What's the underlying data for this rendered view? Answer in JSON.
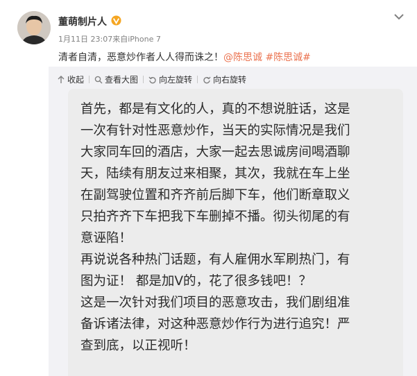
{
  "post": {
    "username": "董萌制片人",
    "time": "1月11日 23:07",
    "source": "来自iPhone 7",
    "text_prefix": "清者自清，恶意炒作者人人得而诛之！",
    "mention": "@陈思诚",
    "hashtag": "#陈思诚#"
  },
  "toolbar": {
    "collapse": "收起",
    "view_large": "查看大图",
    "rotate_left": "向左旋转",
    "rotate_right": "向右旋转"
  },
  "image_text": {
    "lines": [
      "首先，都是有文化的人，真的不想说脏话，这是",
      "一次有针对性恶意炒作，当天的实际情况是我们",
      "大家同车回的酒店，大家一起去思诚房间喝酒聊",
      "天，陆续有朋友过来相聚，其次，我就在车上坐",
      "在副驾驶位置和齐齐前后脚下车，他们断章取义",
      "只拍齐齐下车把我下车删掉不播。彻头彻尾的有",
      "意诬陷！",
      "再说说各种热门话题，有人雇佣水军刷热门，有",
      "图为证！ 都是加V的，花了很多钱吧！？",
      "这是一次针对我们项目的恶意攻击，我们剧组准",
      "备诉诸法律，对这种恶意炒作行为进行追究！严",
      "查到底，以正视听！"
    ]
  },
  "colors": {
    "link": "#eb7350",
    "verified": "#f5a623",
    "image_bg": "#ececec"
  },
  "icons": [
    "avatar",
    "verified-badge-icon",
    "chevron-down-icon",
    "collapse-arrow-icon",
    "magnifier-icon",
    "rotate-left-icon",
    "rotate-right-icon"
  ]
}
